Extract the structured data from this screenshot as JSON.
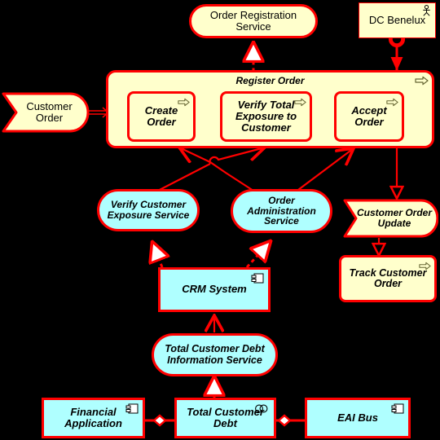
{
  "diagram": {
    "title": "ArchiMate Order Registration Viewpoint",
    "colors": {
      "background": "#000000",
      "business_fill": "#FFFFCC",
      "application_fill": "#AFFFFF",
      "stroke": "#FF0000",
      "text": "#000000"
    }
  },
  "nodes": {
    "order_registration_service": {
      "label": "Order Registration Service",
      "type": "business-service",
      "layer": "business"
    },
    "dc_benelux": {
      "label": "DC Benelux",
      "type": "business-actor",
      "layer": "business",
      "icon": "actor-icon"
    },
    "customer_order": {
      "label": "Customer Order",
      "type": "business-object",
      "layer": "business"
    },
    "register_order": {
      "label": "Register Order",
      "type": "business-process",
      "layer": "business",
      "icon": "process-arrow-icon"
    },
    "create_order": {
      "label": "Create Order",
      "type": "business-process",
      "layer": "business",
      "icon": "process-arrow-icon"
    },
    "verify_total_exposure": {
      "label": "Verify Total Exposure to Customer",
      "type": "business-process",
      "layer": "business",
      "icon": "process-arrow-icon"
    },
    "accept_order": {
      "label": "Accept Order",
      "type": "business-process",
      "layer": "business",
      "icon": "process-arrow-icon"
    },
    "verify_customer_exposure_service": {
      "label": "Verify Customer Exposure Service",
      "type": "application-service",
      "layer": "application"
    },
    "order_administration_service": {
      "label": "Order Administration Service",
      "type": "application-service",
      "layer": "application"
    },
    "customer_order_update": {
      "label": "Customer Order Update",
      "type": "business-object",
      "layer": "business"
    },
    "track_customer_order": {
      "label": "Track Customer Order",
      "type": "business-process",
      "layer": "business",
      "icon": "process-arrow-icon"
    },
    "crm_system": {
      "label": "CRM System",
      "type": "application-component",
      "layer": "application",
      "icon": "component-icon"
    },
    "total_customer_debt_information_service": {
      "label": "Total Customer Debt Information Service",
      "type": "application-service",
      "layer": "application"
    },
    "financial_application": {
      "label": "Financial Application",
      "type": "application-component",
      "layer": "application",
      "icon": "component-icon"
    },
    "total_customer_debt": {
      "label": "Total Customer Debt",
      "type": "application-collaboration",
      "layer": "application",
      "icon": "collaboration-icon"
    },
    "eai_bus": {
      "label": "EAI Bus",
      "type": "application-component",
      "layer": "application",
      "icon": "component-icon"
    }
  },
  "edges": [
    {
      "from": "register_order",
      "to": "order_registration_service",
      "type": "realization"
    },
    {
      "from": "dc_benelux",
      "to": "register_order",
      "type": "assignment"
    },
    {
      "from": "customer_order",
      "to": "register_order",
      "type": "access"
    },
    {
      "from": "create_order",
      "to": "verify_total_exposure",
      "type": "triggering"
    },
    {
      "from": "verify_total_exposure",
      "to": "accept_order",
      "type": "triggering"
    },
    {
      "from": "verify_customer_exposure_service",
      "to": "verify_total_exposure",
      "type": "used-by"
    },
    {
      "from": "order_administration_service",
      "to": "create_order",
      "type": "used-by"
    },
    {
      "from": "order_administration_service",
      "to": "accept_order",
      "type": "used-by"
    },
    {
      "from": "accept_order",
      "to": "customer_order_update",
      "type": "access"
    },
    {
      "from": "customer_order_update",
      "to": "track_customer_order",
      "type": "access"
    },
    {
      "from": "crm_system",
      "to": "verify_customer_exposure_service",
      "type": "realization"
    },
    {
      "from": "crm_system",
      "to": "order_administration_service",
      "type": "realization"
    },
    {
      "from": "total_customer_debt_information_service",
      "to": "crm_system",
      "type": "used-by"
    },
    {
      "from": "total_customer_debt",
      "to": "total_customer_debt_information_service",
      "type": "realization"
    },
    {
      "from": "financial_application",
      "to": "total_customer_debt",
      "type": "association"
    },
    {
      "from": "eai_bus",
      "to": "total_customer_debt",
      "type": "association"
    }
  ]
}
